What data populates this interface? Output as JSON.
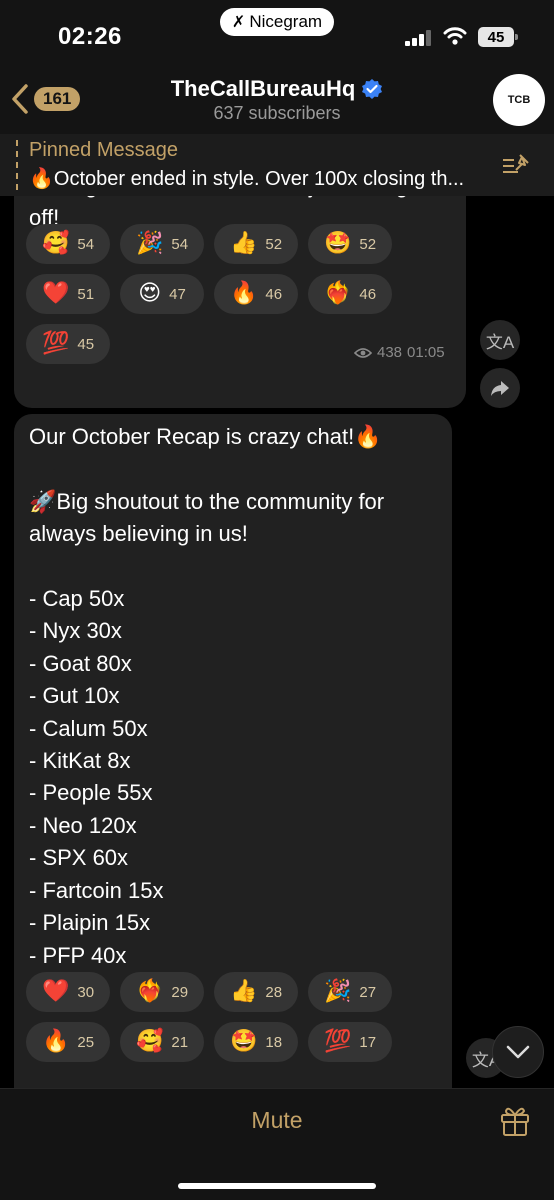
{
  "status_bar": {
    "time": "02:26",
    "carrier_pill": "Nicegram",
    "battery": "45"
  },
  "header": {
    "back_count": "161",
    "title": "TheCallBureauHq",
    "subtitle": "637 subscribers",
    "avatar_text": "TCB"
  },
  "pinned": {
    "title": "Pinned Message",
    "text": "🔥October ended in style. Over 100x closing th..."
  },
  "messages": [
    {
      "text": "closing the month and we’re just taking\noff!",
      "reactions": [
        {
          "emoji": "🥰",
          "count": "54"
        },
        {
          "emoji": "🎉",
          "count": "54"
        },
        {
          "emoji": "👍",
          "count": "52"
        },
        {
          "emoji": "🤩",
          "count": "52"
        },
        {
          "emoji": "❤️",
          "count": "51"
        },
        {
          "emoji": "😍",
          "count": "47"
        },
        {
          "emoji": "🔥",
          "count": "46"
        },
        {
          "emoji": "❤️‍🔥",
          "count": "46"
        },
        {
          "emoji": "💯",
          "count": "45"
        }
      ],
      "views": "438",
      "time": "01:05"
    },
    {
      "text": "Our October Recap is crazy chat!🔥\n\n🚀Big shoutout to the community for\nalways believing in us!\n\n- Cap  50x\n- Nyx  30x\n- Goat  80x\n- Gut  10x\n- Calum  50x\n- KitKat  8x\n- People   55x\n- Neo  120x\n- SPX  60x\n- Fartcoin  15x\n- Plaipin   15x\n- PFP  40x",
      "reactions": [
        {
          "emoji": "❤️",
          "count": "30"
        },
        {
          "emoji": "❤️‍🔥",
          "count": "29"
        },
        {
          "emoji": "👍",
          "count": "28"
        },
        {
          "emoji": "🎉",
          "count": "27"
        },
        {
          "emoji": "🔥",
          "count": "25"
        },
        {
          "emoji": "🥰",
          "count": "21"
        },
        {
          "emoji": "🤩",
          "count": "18"
        },
        {
          "emoji": "💯",
          "count": "17"
        }
      ]
    }
  ],
  "bottom_bar": {
    "mute_label": "Mute"
  },
  "colors": {
    "accent": "#c2a167",
    "bubble": "#212121",
    "reaction_bg": "#343434",
    "verified": "#3b82f6"
  },
  "icons": [
    "back-chevron-icon",
    "verified-icon",
    "pin-list-icon",
    "translate-icon",
    "share-icon",
    "eye-icon",
    "chevron-down-icon",
    "gift-icon",
    "signal-icon",
    "wifi-icon"
  ]
}
